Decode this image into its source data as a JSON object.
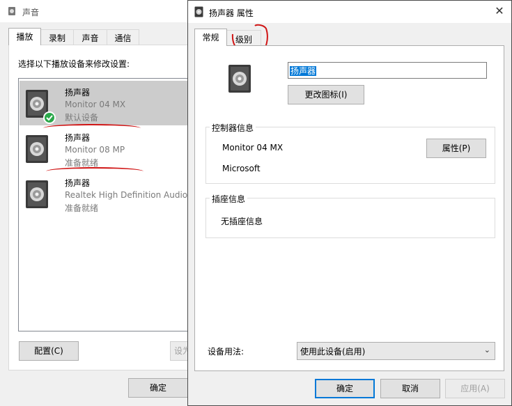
{
  "sound_window": {
    "title": "声音",
    "tabs": [
      "播放",
      "录制",
      "声音",
      "通信"
    ],
    "instruction": "选择以下播放设备来修改设置:",
    "devices": [
      {
        "name": "扬声器",
        "model": "Monitor 04 MX",
        "status": "默认设备",
        "selected": true,
        "default": true
      },
      {
        "name": "扬声器",
        "model": "Monitor 08 MP",
        "status": "准备就绪",
        "selected": false,
        "default": false
      },
      {
        "name": "扬声器",
        "model": "Realtek High Definition Audio",
        "status": "准备就绪",
        "selected": false,
        "default": false
      }
    ],
    "configure_label": "配置(C)",
    "set_default_label": "设为",
    "ok_label": "确定"
  },
  "properties_dialog": {
    "title": "扬声器 属性",
    "close_icon": "close-icon",
    "tabs": [
      "常规",
      "级别"
    ],
    "device_name_value": "扬声器",
    "change_icon_label": "更改图标(I)",
    "controller_group_label": "控制器信息",
    "controller_model": "Monitor 04 MX",
    "controller_vendor": "Microsoft",
    "controller_properties_label": "属性(P)",
    "jack_group_label": "插座信息",
    "jack_info_value": "无插座信息",
    "device_usage_label": "设备用法:",
    "device_usage_value": "使用此设备(启用)",
    "ok_label": "确定",
    "cancel_label": "取消",
    "apply_label": "应用(A)"
  },
  "colors": {
    "accent": "#0078d7",
    "annotation": "#d01515",
    "default_badge": "#2aa84a"
  }
}
